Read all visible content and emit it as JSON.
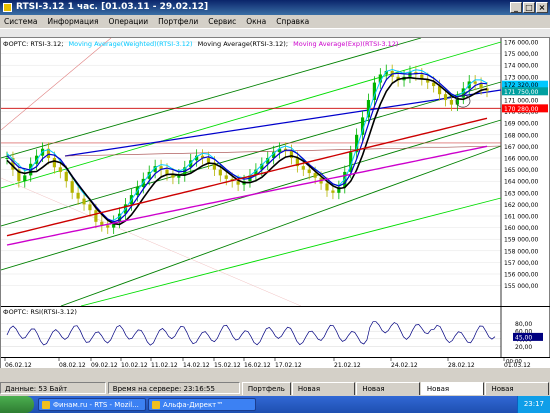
{
  "window": {
    "title": "RTSI-3.12  1 час. [01.03.11 - 29.02.12]",
    "controls": [
      "_",
      "□",
      "×"
    ]
  },
  "menu": [
    "Система",
    "Информация",
    "Операции",
    "Портфели",
    "Сервис",
    "Окна",
    "Справка"
  ],
  "chart": {
    "legend": [
      {
        "label": "ФОРТС: RTSI-3.12;",
        "color": "#000000"
      },
      {
        "label": "Moving Average(Weighted)(RTSI-3.12)",
        "color": "#00c8ff"
      },
      {
        "label": "Moving Average(RTSI-3.12);",
        "color": "#000000"
      },
      {
        "label": "Moving Average(Exp)(RTSI-3.12)",
        "color": "#cc00cc"
      }
    ],
    "price_levels": [
      "176 000,00",
      "175 000,00",
      "174 000,00",
      "173 000,00",
      "172 000,00",
      "171 000,00",
      "170 000,00",
      "169 000,00",
      "168 000,00",
      "167 000,00",
      "166 000,00",
      "165 000,00",
      "164 000,00",
      "163 000,00",
      "162 000,00",
      "161 000,00",
      "160 000,00",
      "159 000,00",
      "158 000,00",
      "157 000,00",
      "156 000,00",
      "155 000,00"
    ],
    "current_price_label": "170 280,00",
    "ma_labels": [
      "172 320,00",
      "171 750,00"
    ],
    "colors": {
      "candle_up": "#00b400",
      "candle_down": "#b4b400",
      "red_line": "#cc0000",
      "pink_ma": "#cc00cc",
      "blue_line": "#0000cc",
      "green_lines": "#008000",
      "bright_green": "#00dd00"
    }
  },
  "rsi": {
    "label": "ФОРТС: RSI(RTSI-3.12)",
    "levels": [
      "80,00",
      "60,00",
      "40,00",
      "20,00"
    ],
    "current_value": "45,00"
  },
  "xaxis": {
    "dates": [
      "06.02.12",
      "08.02.12",
      "09.02.12",
      "10.02.12",
      "11.02.12",
      "14.02.12",
      "15.02.12",
      "16.02.12",
      "17.02.12",
      "21.02.12",
      "24.02.12",
      "28.02.12",
      "01.03.12"
    ],
    "right_time": "00:00"
  },
  "status": {
    "data": "Данные: 53 Байт",
    "server_time": "Время на сервере: 23:16:55 29.02.2012 MSK",
    "tabs": [
      "Портфель",
      "Новая вкладка",
      "Новая вкладка",
      "Новая вкладка",
      "Новая вкладка"
    ],
    "active_tab_index": 3
  },
  "taskbar": {
    "items": [
      "Финам.ru - RTS - Mozil...",
      "Альфа-Директ™"
    ],
    "clock": "23:17"
  }
}
